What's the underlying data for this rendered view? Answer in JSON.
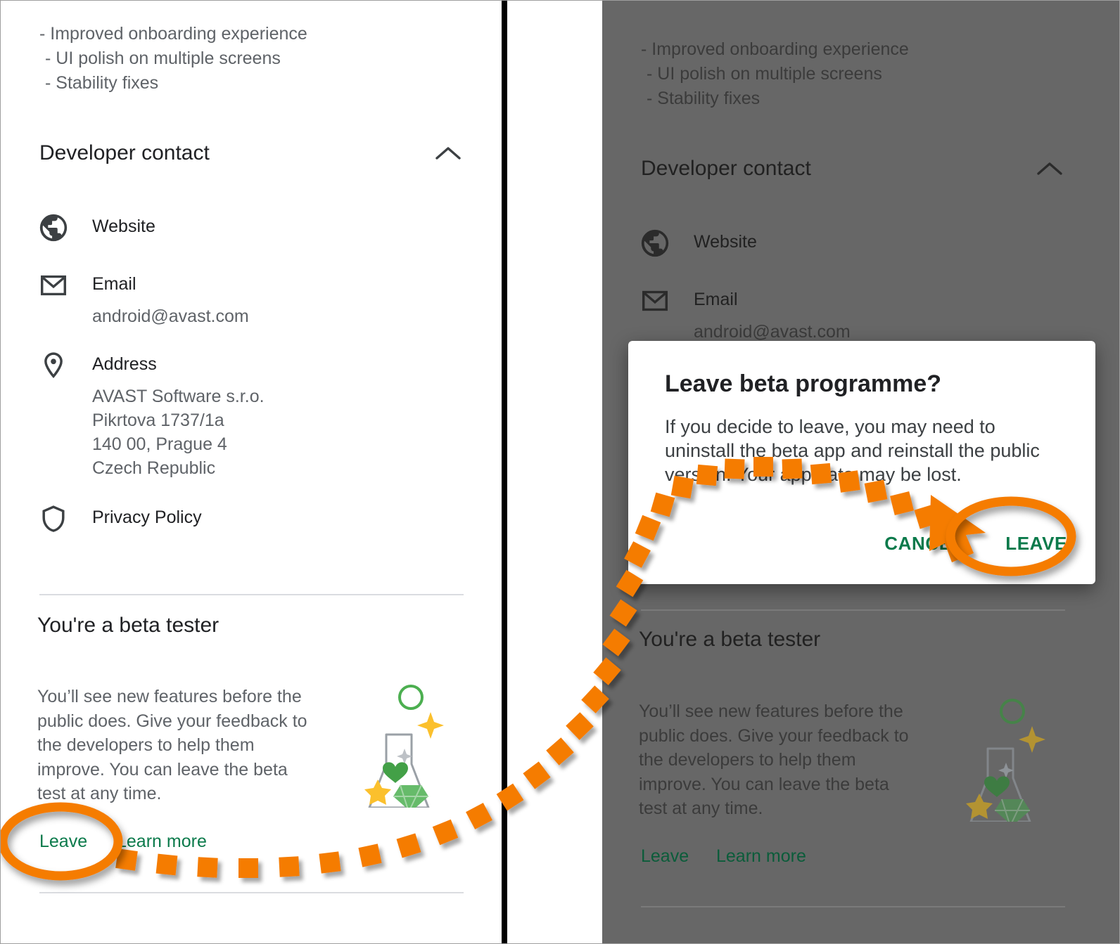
{
  "colors": {
    "accent_orange": "#F57C00",
    "link_green": "#0B7A4B",
    "text_primary": "#202124",
    "text_secondary": "#5F6368",
    "dim_overlay": "#676767",
    "divider": "#DADCE0",
    "flask_heart": "#43A047",
    "flask_star": "#FBC02D",
    "flask_gem": "#66BB6A",
    "flask_ring": "#4CAF50"
  },
  "whats_new": {
    "lines": [
      "- Improved onboarding experience",
      "- UI polish on multiple screens",
      "- Stability fixes"
    ]
  },
  "developer_contact": {
    "title": "Developer contact",
    "collapse_icon": "chevron-up-icon",
    "items": [
      {
        "icon": "globe-icon",
        "label": "Website",
        "value": ""
      },
      {
        "icon": "email-icon",
        "label": "Email",
        "value": "android@avast.com"
      },
      {
        "icon": "pin-icon",
        "label": "Address",
        "value": ""
      },
      {
        "icon": "shield-icon",
        "label": "Privacy Policy",
        "value": ""
      }
    ],
    "address_lines": [
      "AVAST Software s.r.o.",
      "Pikrtova 1737/1a",
      "140 00, Prague 4",
      "Czech Republic"
    ]
  },
  "beta": {
    "title": "You're a beta tester",
    "body": "You’ll see new features before the public does. Give your feedback to the developers to help them improve. You can leave the beta test at any time.",
    "leave_label": "Leave",
    "learn_more_label": "Learn more",
    "illustration": "beta-flask-illustration"
  },
  "dialog": {
    "title": "Leave beta programme?",
    "body": "If you decide to leave, you may need to uninstall the beta app and reinstall the public version. Your app data may be lost.",
    "cancel_label": "CANCEL",
    "leave_label": "LEAVE"
  },
  "annotations": {
    "highlight_left": "ellipse-highlight-leave-link",
    "highlight_right": "ellipse-highlight-leave-button",
    "path": "dotted-arrow-path",
    "arrowhead": "arrow-head-icon"
  }
}
